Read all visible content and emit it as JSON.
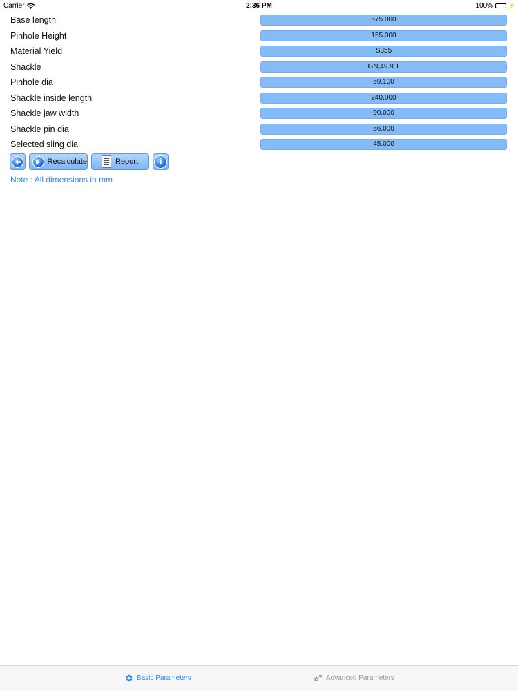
{
  "status_bar": {
    "carrier": "Carrier",
    "time": "2:36 PM",
    "battery": "100%"
  },
  "params": [
    {
      "label": "Base length",
      "value": "575.000"
    },
    {
      "label": "Pinhole Height",
      "value": "155.000"
    },
    {
      "label": "Material Yield",
      "value": "S355"
    },
    {
      "label": "Shackle",
      "value": "GN,49.9 T"
    },
    {
      "label": "Pinhole dia",
      "value": "59.100"
    },
    {
      "label": "Shackle inside length",
      "value": "240.000"
    },
    {
      "label": "Shackle jaw width",
      "value": "90.000"
    },
    {
      "label": "Shackle pin dia",
      "value": "56.000"
    },
    {
      "label": "Selected sling dia",
      "value": "45.000"
    }
  ],
  "toolbar": {
    "back_icon": "back-arrow-icon",
    "recalculate_label": "Recalculate",
    "report_label": "Report",
    "info_icon": "info-icon"
  },
  "note": "Note : All dimensions in mm",
  "tabs": {
    "basic": {
      "label": "Basic Parameters",
      "icon": "gear-icon",
      "active": true,
      "color": "#2f8be8"
    },
    "advanced": {
      "label": "Advanced Parameters",
      "icon": "gears-icon",
      "active": false,
      "color": "#999999"
    }
  },
  "colors": {
    "field_bg": "#85bcf7",
    "accent": "#2f8be8"
  }
}
